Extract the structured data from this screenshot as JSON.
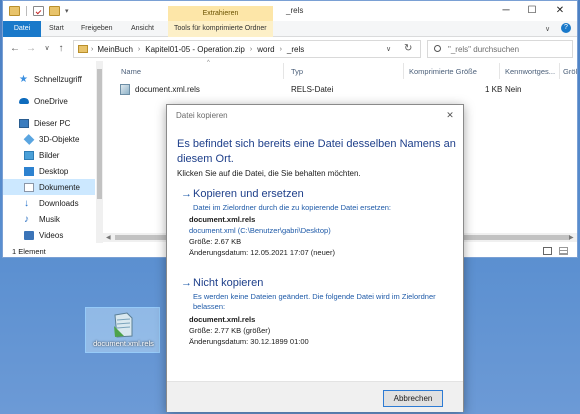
{
  "window": {
    "context_header": "Extrahieren",
    "title": "_rels",
    "controls": {
      "minimize": "─",
      "maximize": "☐",
      "close": "✕"
    }
  },
  "ribbon": {
    "tabs": [
      "Datei",
      "Start",
      "Freigeben",
      "Ansicht",
      "Tools für komprimierte Ordner"
    ]
  },
  "address": {
    "back": "←",
    "forward": "→",
    "recent": "∨",
    "up": "↑",
    "breadcrumbs": [
      "MeinBuch",
      "Kapitel01-05 - Operation.zip",
      "word",
      "_rels"
    ],
    "separator": "›",
    "dropdown": "∨",
    "refresh": "↻"
  },
  "search": {
    "placeholder": "\"_rels\" durchsuchen",
    "icon": "search-icon"
  },
  "navpane": {
    "items": [
      {
        "label": "Schnellzugriff",
        "icon": "star-icon",
        "color": "#3a8fe0"
      },
      {
        "label": "OneDrive",
        "icon": "cloud-icon",
        "color": "#0f6cbd"
      },
      {
        "label": "Dieser PC",
        "icon": "computer-icon",
        "color": "#3b7dbf"
      },
      {
        "label": "3D-Objekte",
        "icon": "cube-icon",
        "color": "#5aa5e0"
      },
      {
        "label": "Bilder",
        "icon": "pictures-icon",
        "color": "#4aa0d8"
      },
      {
        "label": "Desktop",
        "icon": "desktop-icon",
        "color": "#2d82d0"
      },
      {
        "label": "Dokumente",
        "icon": "documents-icon",
        "color": "#8a96a8"
      },
      {
        "label": "Downloads",
        "icon": "download-icon",
        "color": "#1f6fc9"
      },
      {
        "label": "Musik",
        "icon": "music-icon",
        "color": "#2a6fc0"
      },
      {
        "label": "Videos",
        "icon": "video-icon",
        "color": "#3b74b8"
      }
    ],
    "selected": "Dokumente"
  },
  "content": {
    "columns": [
      "Name",
      "Typ",
      "Komprimierte Größe",
      "Kennwortges...",
      "Größ"
    ],
    "rows": [
      {
        "name": "document.xml.rels",
        "type": "RELS-Datei",
        "compressed": "1 KB",
        "password": "Nein",
        "icon": "xml-file-icon"
      }
    ]
  },
  "status": {
    "text": "1 Element"
  },
  "desktop_icon": {
    "label": "document.xml.rels",
    "icon": "xml-file-icon"
  },
  "dialog": {
    "title": "Datei kopieren",
    "close": "✕",
    "heading": "Es befindet sich bereits eine Datei desselben Namens an diesem Ort.",
    "sub": "Klicken Sie auf die Datei, die Sie behalten möchten.",
    "arrow": "→",
    "option_replace": {
      "head": "Kopieren und ersetzen",
      "desc": "Datei im Zielordner durch die zu kopierende Datei ersetzen:",
      "filename": "document.xml.rels",
      "location": "document.xml (C:\\Benutzer\\gabri\\Desktop)",
      "size": "Größe: 2.67 KB",
      "date": "Änderungsdatum: 12.05.2021 17:07 (neuer)"
    },
    "option_skip": {
      "head": "Nicht kopieren",
      "desc": "Es werden keine Dateien geändert. Die folgende Datei wird im Zielordner belassen:",
      "filename": "document.xml.rels",
      "size": "Größe: 2.77 KB (größer)",
      "date": "Änderungsdatum: 30.12.1899 01:00"
    },
    "cancel_label": "Abbrechen"
  },
  "colors": {
    "accent": "#1979ca",
    "heading": "#1e3f8a",
    "link": "#1e5aa8",
    "context": "#fde6a8"
  }
}
